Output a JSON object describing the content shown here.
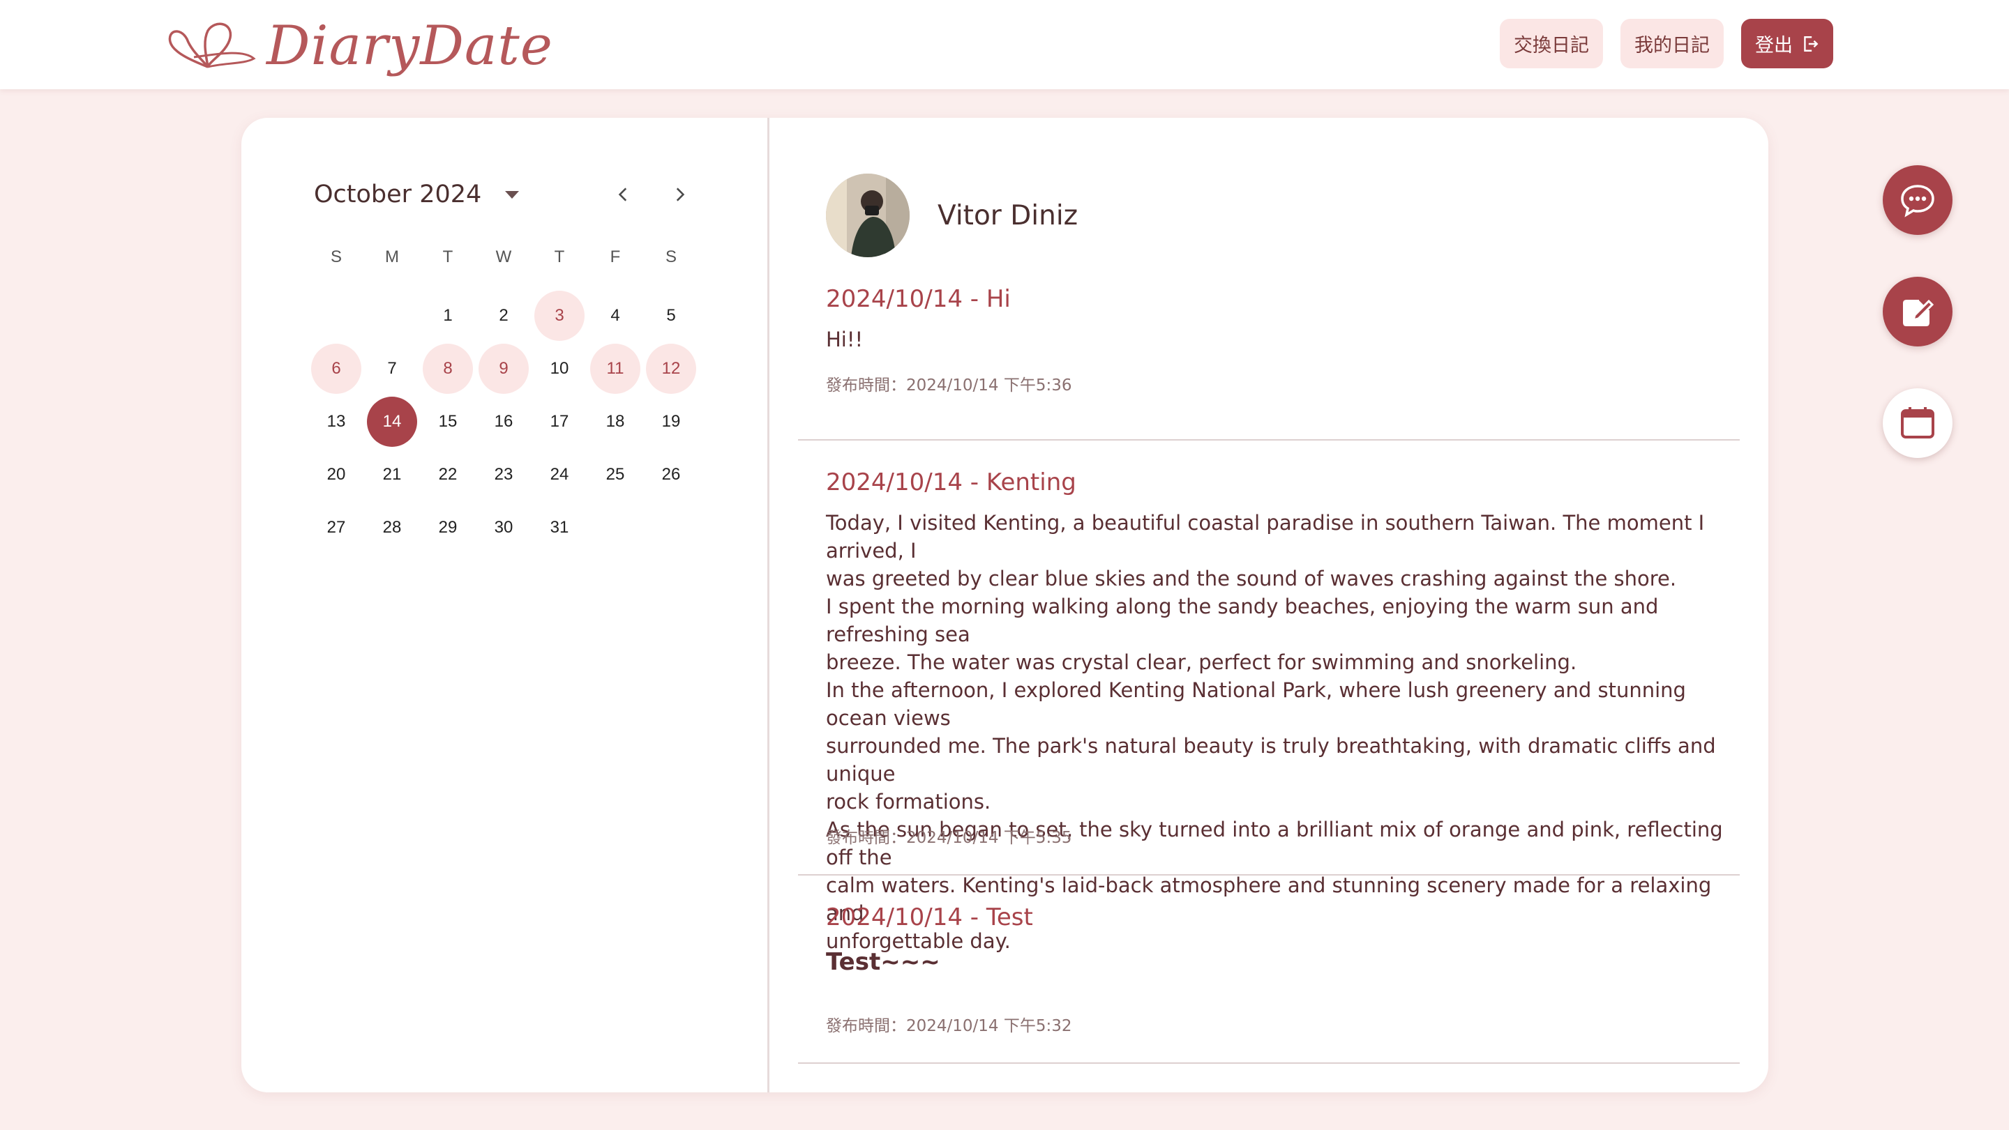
{
  "app": {
    "brand": "DiaryDate"
  },
  "nav": {
    "exchange_diary": "交換日記",
    "my_diary": "我的日記",
    "logout": "登出"
  },
  "calendar": {
    "month_label": "October 2024",
    "weekdays": [
      "S",
      "M",
      "T",
      "W",
      "T",
      "F",
      "S"
    ],
    "days": [
      "1",
      "2",
      "3",
      "4",
      "5",
      "6",
      "7",
      "8",
      "9",
      "10",
      "11",
      "12",
      "13",
      "14",
      "15",
      "16",
      "17",
      "18",
      "19",
      "20",
      "21",
      "22",
      "23",
      "24",
      "25",
      "26",
      "27",
      "28",
      "29",
      "30",
      "31"
    ],
    "entry_days": [
      "3",
      "6",
      "8",
      "9",
      "11",
      "12"
    ],
    "selected_day": "14"
  },
  "user": {
    "name": "Vitor Diniz"
  },
  "entries": [
    {
      "title": "2024/10/14 - Hi",
      "body": "Hi!!",
      "time": "發布時間：2024/10/14 下午5:36"
    },
    {
      "title": "2024/10/14 - Kenting",
      "body": "Today, I visited Kenting, a beautiful coastal paradise in southern Taiwan. The moment I arrived, I\nwas greeted by clear blue skies and the sound of waves crashing against the shore.\nI spent the morning walking along the sandy beaches, enjoying the warm sun and refreshing sea\nbreeze. The water was crystal clear, perfect for swimming and snorkeling.\nIn the afternoon, I explored Kenting National Park, where lush greenery and stunning ocean views\nsurrounded me. The park's natural beauty is truly breathtaking, with dramatic cliffs and unique\nrock formations.\nAs the sun began to set, the sky turned into a brilliant mix of orange and pink, reflecting off the\ncalm waters. Kenting's laid-back atmosphere and stunning scenery made for a relaxing and\nunforgettable day.",
      "time": "發布時間：2024/10/14 下午5:35"
    },
    {
      "title": "2024/10/14 - Test",
      "body": "Test~~~",
      "time": "發布時間：2024/10/14 下午5:32"
    }
  ],
  "fabs": {
    "chat": "chat-bubble-icon",
    "write": "edit-icon",
    "calendar": "calendar-icon"
  },
  "colors": {
    "accent": "#a8434a",
    "accent_soft": "#fbe6e5",
    "page_bg": "#fbeeed"
  }
}
